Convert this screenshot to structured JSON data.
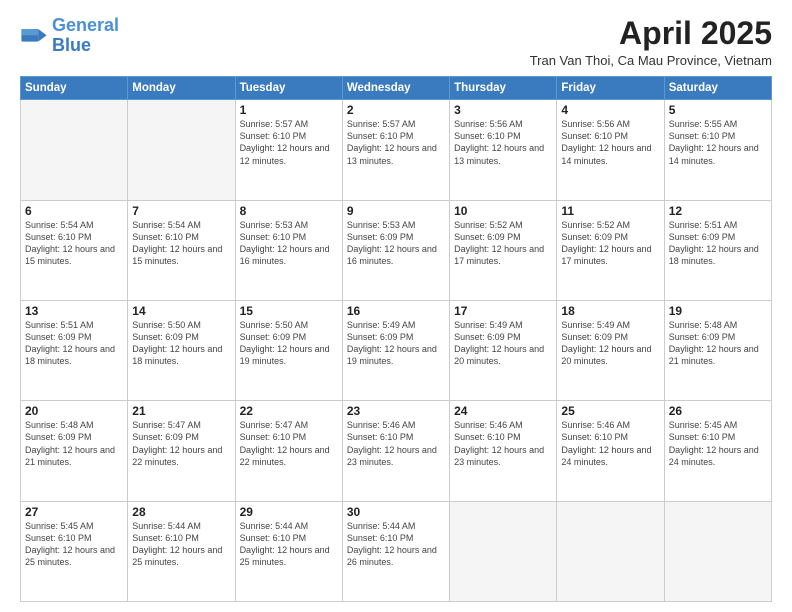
{
  "header": {
    "logo_general": "General",
    "logo_blue": "Blue",
    "month_title": "April 2025",
    "location": "Tran Van Thoi, Ca Mau Province, Vietnam"
  },
  "days_of_week": [
    "Sunday",
    "Monday",
    "Tuesday",
    "Wednesday",
    "Thursday",
    "Friday",
    "Saturday"
  ],
  "weeks": [
    [
      {
        "day": "",
        "info": ""
      },
      {
        "day": "",
        "info": ""
      },
      {
        "day": "1",
        "info": "Sunrise: 5:57 AM\nSunset: 6:10 PM\nDaylight: 12 hours and 12 minutes."
      },
      {
        "day": "2",
        "info": "Sunrise: 5:57 AM\nSunset: 6:10 PM\nDaylight: 12 hours and 13 minutes."
      },
      {
        "day": "3",
        "info": "Sunrise: 5:56 AM\nSunset: 6:10 PM\nDaylight: 12 hours and 13 minutes."
      },
      {
        "day": "4",
        "info": "Sunrise: 5:56 AM\nSunset: 6:10 PM\nDaylight: 12 hours and 14 minutes."
      },
      {
        "day": "5",
        "info": "Sunrise: 5:55 AM\nSunset: 6:10 PM\nDaylight: 12 hours and 14 minutes."
      }
    ],
    [
      {
        "day": "6",
        "info": "Sunrise: 5:54 AM\nSunset: 6:10 PM\nDaylight: 12 hours and 15 minutes."
      },
      {
        "day": "7",
        "info": "Sunrise: 5:54 AM\nSunset: 6:10 PM\nDaylight: 12 hours and 15 minutes."
      },
      {
        "day": "8",
        "info": "Sunrise: 5:53 AM\nSunset: 6:10 PM\nDaylight: 12 hours and 16 minutes."
      },
      {
        "day": "9",
        "info": "Sunrise: 5:53 AM\nSunset: 6:09 PM\nDaylight: 12 hours and 16 minutes."
      },
      {
        "day": "10",
        "info": "Sunrise: 5:52 AM\nSunset: 6:09 PM\nDaylight: 12 hours and 17 minutes."
      },
      {
        "day": "11",
        "info": "Sunrise: 5:52 AM\nSunset: 6:09 PM\nDaylight: 12 hours and 17 minutes."
      },
      {
        "day": "12",
        "info": "Sunrise: 5:51 AM\nSunset: 6:09 PM\nDaylight: 12 hours and 18 minutes."
      }
    ],
    [
      {
        "day": "13",
        "info": "Sunrise: 5:51 AM\nSunset: 6:09 PM\nDaylight: 12 hours and 18 minutes."
      },
      {
        "day": "14",
        "info": "Sunrise: 5:50 AM\nSunset: 6:09 PM\nDaylight: 12 hours and 18 minutes."
      },
      {
        "day": "15",
        "info": "Sunrise: 5:50 AM\nSunset: 6:09 PM\nDaylight: 12 hours and 19 minutes."
      },
      {
        "day": "16",
        "info": "Sunrise: 5:49 AM\nSunset: 6:09 PM\nDaylight: 12 hours and 19 minutes."
      },
      {
        "day": "17",
        "info": "Sunrise: 5:49 AM\nSunset: 6:09 PM\nDaylight: 12 hours and 20 minutes."
      },
      {
        "day": "18",
        "info": "Sunrise: 5:49 AM\nSunset: 6:09 PM\nDaylight: 12 hours and 20 minutes."
      },
      {
        "day": "19",
        "info": "Sunrise: 5:48 AM\nSunset: 6:09 PM\nDaylight: 12 hours and 21 minutes."
      }
    ],
    [
      {
        "day": "20",
        "info": "Sunrise: 5:48 AM\nSunset: 6:09 PM\nDaylight: 12 hours and 21 minutes."
      },
      {
        "day": "21",
        "info": "Sunrise: 5:47 AM\nSunset: 6:09 PM\nDaylight: 12 hours and 22 minutes."
      },
      {
        "day": "22",
        "info": "Sunrise: 5:47 AM\nSunset: 6:10 PM\nDaylight: 12 hours and 22 minutes."
      },
      {
        "day": "23",
        "info": "Sunrise: 5:46 AM\nSunset: 6:10 PM\nDaylight: 12 hours and 23 minutes."
      },
      {
        "day": "24",
        "info": "Sunrise: 5:46 AM\nSunset: 6:10 PM\nDaylight: 12 hours and 23 minutes."
      },
      {
        "day": "25",
        "info": "Sunrise: 5:46 AM\nSunset: 6:10 PM\nDaylight: 12 hours and 24 minutes."
      },
      {
        "day": "26",
        "info": "Sunrise: 5:45 AM\nSunset: 6:10 PM\nDaylight: 12 hours and 24 minutes."
      }
    ],
    [
      {
        "day": "27",
        "info": "Sunrise: 5:45 AM\nSunset: 6:10 PM\nDaylight: 12 hours and 25 minutes."
      },
      {
        "day": "28",
        "info": "Sunrise: 5:44 AM\nSunset: 6:10 PM\nDaylight: 12 hours and 25 minutes."
      },
      {
        "day": "29",
        "info": "Sunrise: 5:44 AM\nSunset: 6:10 PM\nDaylight: 12 hours and 25 minutes."
      },
      {
        "day": "30",
        "info": "Sunrise: 5:44 AM\nSunset: 6:10 PM\nDaylight: 12 hours and 26 minutes."
      },
      {
        "day": "",
        "info": ""
      },
      {
        "day": "",
        "info": ""
      },
      {
        "day": "",
        "info": ""
      }
    ]
  ]
}
